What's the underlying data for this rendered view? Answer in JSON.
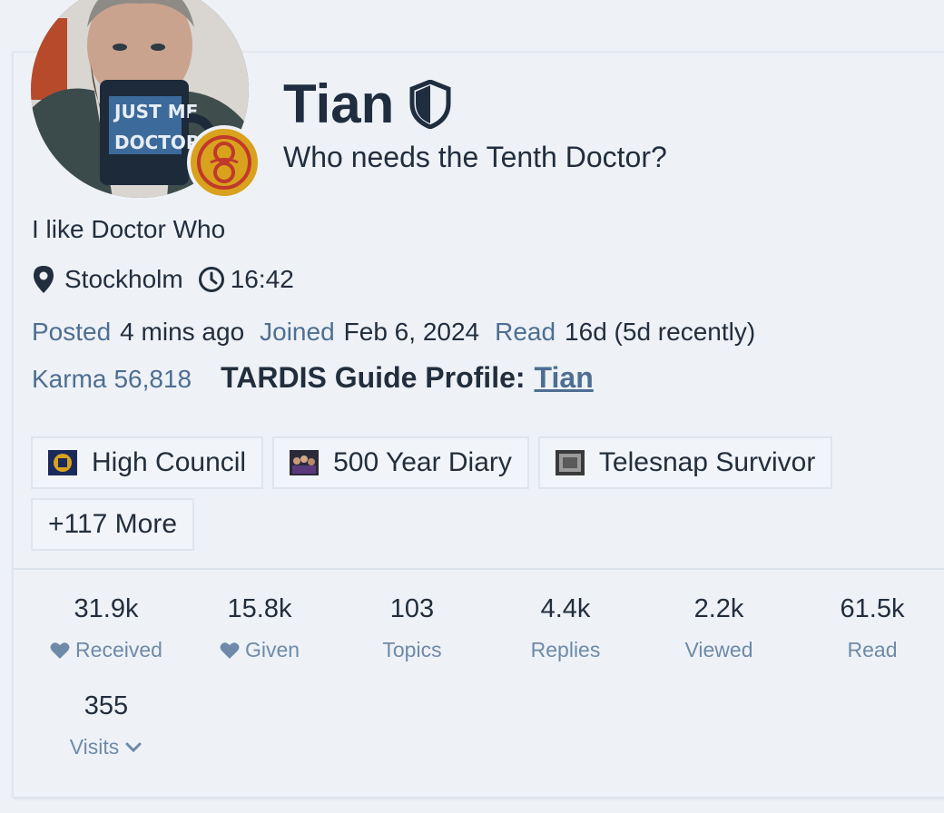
{
  "profile": {
    "name": "Tian",
    "tagline": "Who needs the Tenth Doctor?",
    "bio": "I like Doctor Who",
    "location": "Stockholm",
    "local_time": "16:42",
    "posted_label": "Posted",
    "posted_value": "4 mins ago",
    "joined_label": "Joined",
    "joined_value": "Feb 6, 2024",
    "read_label": "Read",
    "read_value": "16d (5d recently)",
    "karma_label": "Karma",
    "karma_value": "56,818",
    "tardis_label": "TARDIS Guide Profile:",
    "tardis_link": "Tian"
  },
  "badges": [
    {
      "label": "High Council",
      "icon": "high-council-badge-icon"
    },
    {
      "label": "500 Year Diary",
      "icon": "500-year-diary-badge-icon"
    },
    {
      "label": "Telesnap Survivor",
      "icon": "telesnap-survivor-badge-icon"
    },
    {
      "label": "+117 More"
    }
  ],
  "stats": [
    {
      "value": "31.9k",
      "label": "Received",
      "icon": "heart-icon"
    },
    {
      "value": "15.8k",
      "label": "Given",
      "icon": "heart-icon"
    },
    {
      "value": "103",
      "label": "Topics"
    },
    {
      "value": "4.4k",
      "label": "Replies"
    },
    {
      "value": "2.2k",
      "label": "Viewed"
    },
    {
      "value": "61.5k",
      "label": "Read"
    },
    {
      "value": "355",
      "label": "Visits",
      "icon": "chevron-down-icon"
    }
  ],
  "colors": {
    "accent": "#4e6e92",
    "text": "#222e3d",
    "muted": "#6f8aa8",
    "background": "#eef2f7"
  }
}
